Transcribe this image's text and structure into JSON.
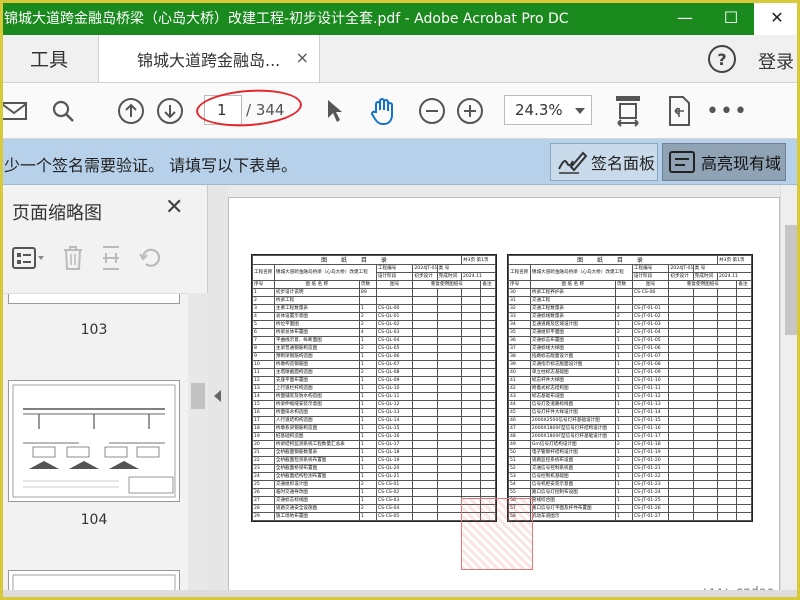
{
  "window": {
    "title": "锦城大道跨金融岛桥梁（心岛大桥）改建工程-初步设计全套.pdf - Adobe Acrobat Pro DC",
    "minimize": "—",
    "maximize": "☐",
    "close": "✕"
  },
  "tabs": {
    "tools": "工具",
    "document": "锦城大道跨金融岛...",
    "close": "×",
    "help": "?",
    "login": "登录"
  },
  "toolbar": {
    "page_current": "1",
    "page_total": "/ 344",
    "zoom": "24.3%"
  },
  "signature_bar": {
    "message": "少一个签名需要验证。 请填写以下表单。",
    "sign_panel": "签名面板",
    "highlight_fields": "高亮现有域"
  },
  "thumbnails": {
    "title": "页面缩略图",
    "pages": [
      "103",
      "104"
    ]
  },
  "sheet_left": {
    "heading": "图 纸 目 录",
    "page_info": "共3页 第1页",
    "project_label": "工程名称",
    "project": "锦城大道跨金融岛桥梁（心岛大桥）改建工程",
    "proj_no_label": "工程编号",
    "proj_no": "2024JT-018",
    "category_label": "类 号",
    "stage": "设计阶段",
    "stage_val": "初步设计",
    "done_label": "完成时间",
    "done_val": "2024.11",
    "col_no": "序号",
    "col_name": "图 纸 名 称",
    "col_pages": "页数",
    "col_code": "图号",
    "col_reuse": "重复使用图纸号",
    "col_note": "备注",
    "rows": [
      [
        "1",
        "初步设计说明",
        "89",
        ""
      ],
      [
        "2",
        "桥梁工程",
        "",
        ""
      ],
      [
        "3",
        "主要工程数量表",
        "1",
        "CS-QL-00"
      ],
      [
        "4",
        "总体设置示意图",
        "2",
        "CS-QL-01"
      ],
      [
        "5",
        "桥位平面图",
        "2",
        "CS-QL-02"
      ],
      [
        "6",
        "桥梁总体布置图",
        "4",
        "CS-QL-03"
      ],
      [
        "7",
        "平曲线示意、纵断面图",
        "1",
        "CS-QL-04"
      ],
      [
        "8",
        "主梁普通钢筋构造图",
        "2",
        "CS-QL-05"
      ],
      [
        "9",
        "预制梁钢筋构造图",
        "1",
        "CS-QL-06"
      ],
      [
        "10",
        "桥墩构造钢筋图",
        "1",
        "CS-QL-07"
      ],
      [
        "11",
        "主塔墩截面构造图",
        "2",
        "CS-QL-08"
      ],
      [
        "12",
        "支座平面布置图",
        "1",
        "CS-QL-09"
      ],
      [
        "13",
        "上行道栏杆构造图",
        "1",
        "CS-QL-10"
      ],
      [
        "14",
        "桥面铺装及防水构造图",
        "1",
        "CS-QL-11"
      ],
      [
        "15",
        "桥梁伸缩缝安装示意图",
        "1",
        "CS-QL-12"
      ],
      [
        "16",
        "桥面排水构造图",
        "1",
        "CS-QL-13"
      ],
      [
        "17",
        "人行道结构构造图",
        "1",
        "CS-QL-14"
      ],
      [
        "18",
        "桥墩系梁钢筋构造图",
        "1",
        "CS-QL-15"
      ],
      [
        "19",
        "桩基础构造图",
        "1",
        "CS-QL-16"
      ],
      [
        "20",
        "桥梁结构监测系统工程数量汇总表",
        "1",
        "CS-QL-17"
      ],
      [
        "21",
        "全桥截面钢筋数量表",
        "1",
        "CS-QL-18"
      ],
      [
        "22",
        "全桥截面检测系统布置图",
        "1",
        "CS-QL-19"
      ],
      [
        "23",
        "全桥截面桥梁布置图",
        "1",
        "CS-QL-20"
      ],
      [
        "24",
        "全桥截面结构检测布置图",
        "1",
        "CS-QL-21"
      ],
      [
        "25",
        "交通组织设计图",
        "2",
        "CS-CS-01"
      ],
      [
        "26",
        "临时交通导改图",
        "1",
        "CS-CS-02"
      ],
      [
        "27",
        "交通标志标线图",
        "1",
        "CS-CS-03"
      ],
      [
        "28",
        "道路交通安全设施图",
        "2",
        "CS-CS-04"
      ],
      [
        "29",
        "施工场地布置图",
        "1",
        "CS-CS-05"
      ]
    ]
  },
  "sheet_right": {
    "heading": "图 纸 目 录",
    "page_info": "共3页 第1页",
    "rows": [
      [
        "30",
        "桥梁工程养护表",
        "",
        "CS-CS-06"
      ],
      [
        "31",
        "交通工程",
        "",
        ""
      ],
      [
        "32",
        "交通工程数量表",
        "4",
        "CS-JT-01-01"
      ],
      [
        "33",
        "交通标线数量表",
        "2",
        "CS-JT-01-02"
      ],
      [
        "34",
        "互通道路及区域设计图",
        "1",
        "CS-JT-01-03"
      ],
      [
        "35",
        "交通组织平面图",
        "2",
        "CS-JT-01-04"
      ],
      [
        "36",
        "交通标志布置图",
        "1",
        "CS-JT-01-05"
      ],
      [
        "37",
        "交通标线大样图",
        "1",
        "CS-JT-01-06"
      ],
      [
        "38",
        "指路标志版面设计图",
        "1",
        "CS-JT-01-07"
      ],
      [
        "39",
        "交通指示标志版面设计图",
        "1",
        "CS-JT-01-08"
      ],
      [
        "40",
        "单立柱标志基础图",
        "1",
        "CS-JT-01-09"
      ],
      [
        "41",
        "标志杆件大样图",
        "1",
        "CS-JT-01-10"
      ],
      [
        "42",
        "附着式标志结构图",
        "1",
        "CS-JT-01-11"
      ],
      [
        "43",
        "标志基础布设图",
        "1",
        "CS-JT-01-12"
      ],
      [
        "44",
        "信号灯及道路标线图",
        "1",
        "CS-JT-01-13"
      ],
      [
        "45",
        "信号灯杆件大样设计图",
        "1",
        "CS-JT-01-14"
      ],
      [
        "46",
        "2000X2500信号灯杆基础设计图",
        "1",
        "CS-JT-01-15"
      ],
      [
        "47",
        "2000X1800F型信号灯杆结构设计图",
        "1",
        "CS-JT-01-16"
      ],
      [
        "48",
        "2000X1800F型信号灯杆基础设计图",
        "1",
        "CS-JT-01-17"
      ],
      [
        "49",
        "Gm信号灯结构设计图",
        "2",
        "CS-JT-01-18"
      ],
      [
        "50",
        "电子警察杆结构设计图",
        "1",
        "CS-JT-01-19"
      ],
      [
        "51",
        "道路监控系统布设图",
        "2",
        "CS-JT-01-20"
      ],
      [
        "52",
        "交通信号控制系统图",
        "1",
        "CS-JT-01-21"
      ],
      [
        "53",
        "信号控制机基础图",
        "1",
        "CS-JT-01-22"
      ],
      [
        "54",
        "信号机柜安装示意图",
        "1",
        "CS-JT-01-23"
      ],
      [
        "55",
        "路口信号灯控制布设图",
        "1",
        "CS-JT-01-24"
      ],
      [
        "56",
        "管线综合图",
        "1",
        "CS-JT-01-25"
      ],
      [
        "57",
        "路口信号灯平面及杆件布置图",
        "1",
        "CS-JT-01-26"
      ],
      [
        "58",
        "机动车道图示",
        "1",
        "CS-JT-01-27"
      ]
    ]
  },
  "watermark": "www.cndao.com"
}
